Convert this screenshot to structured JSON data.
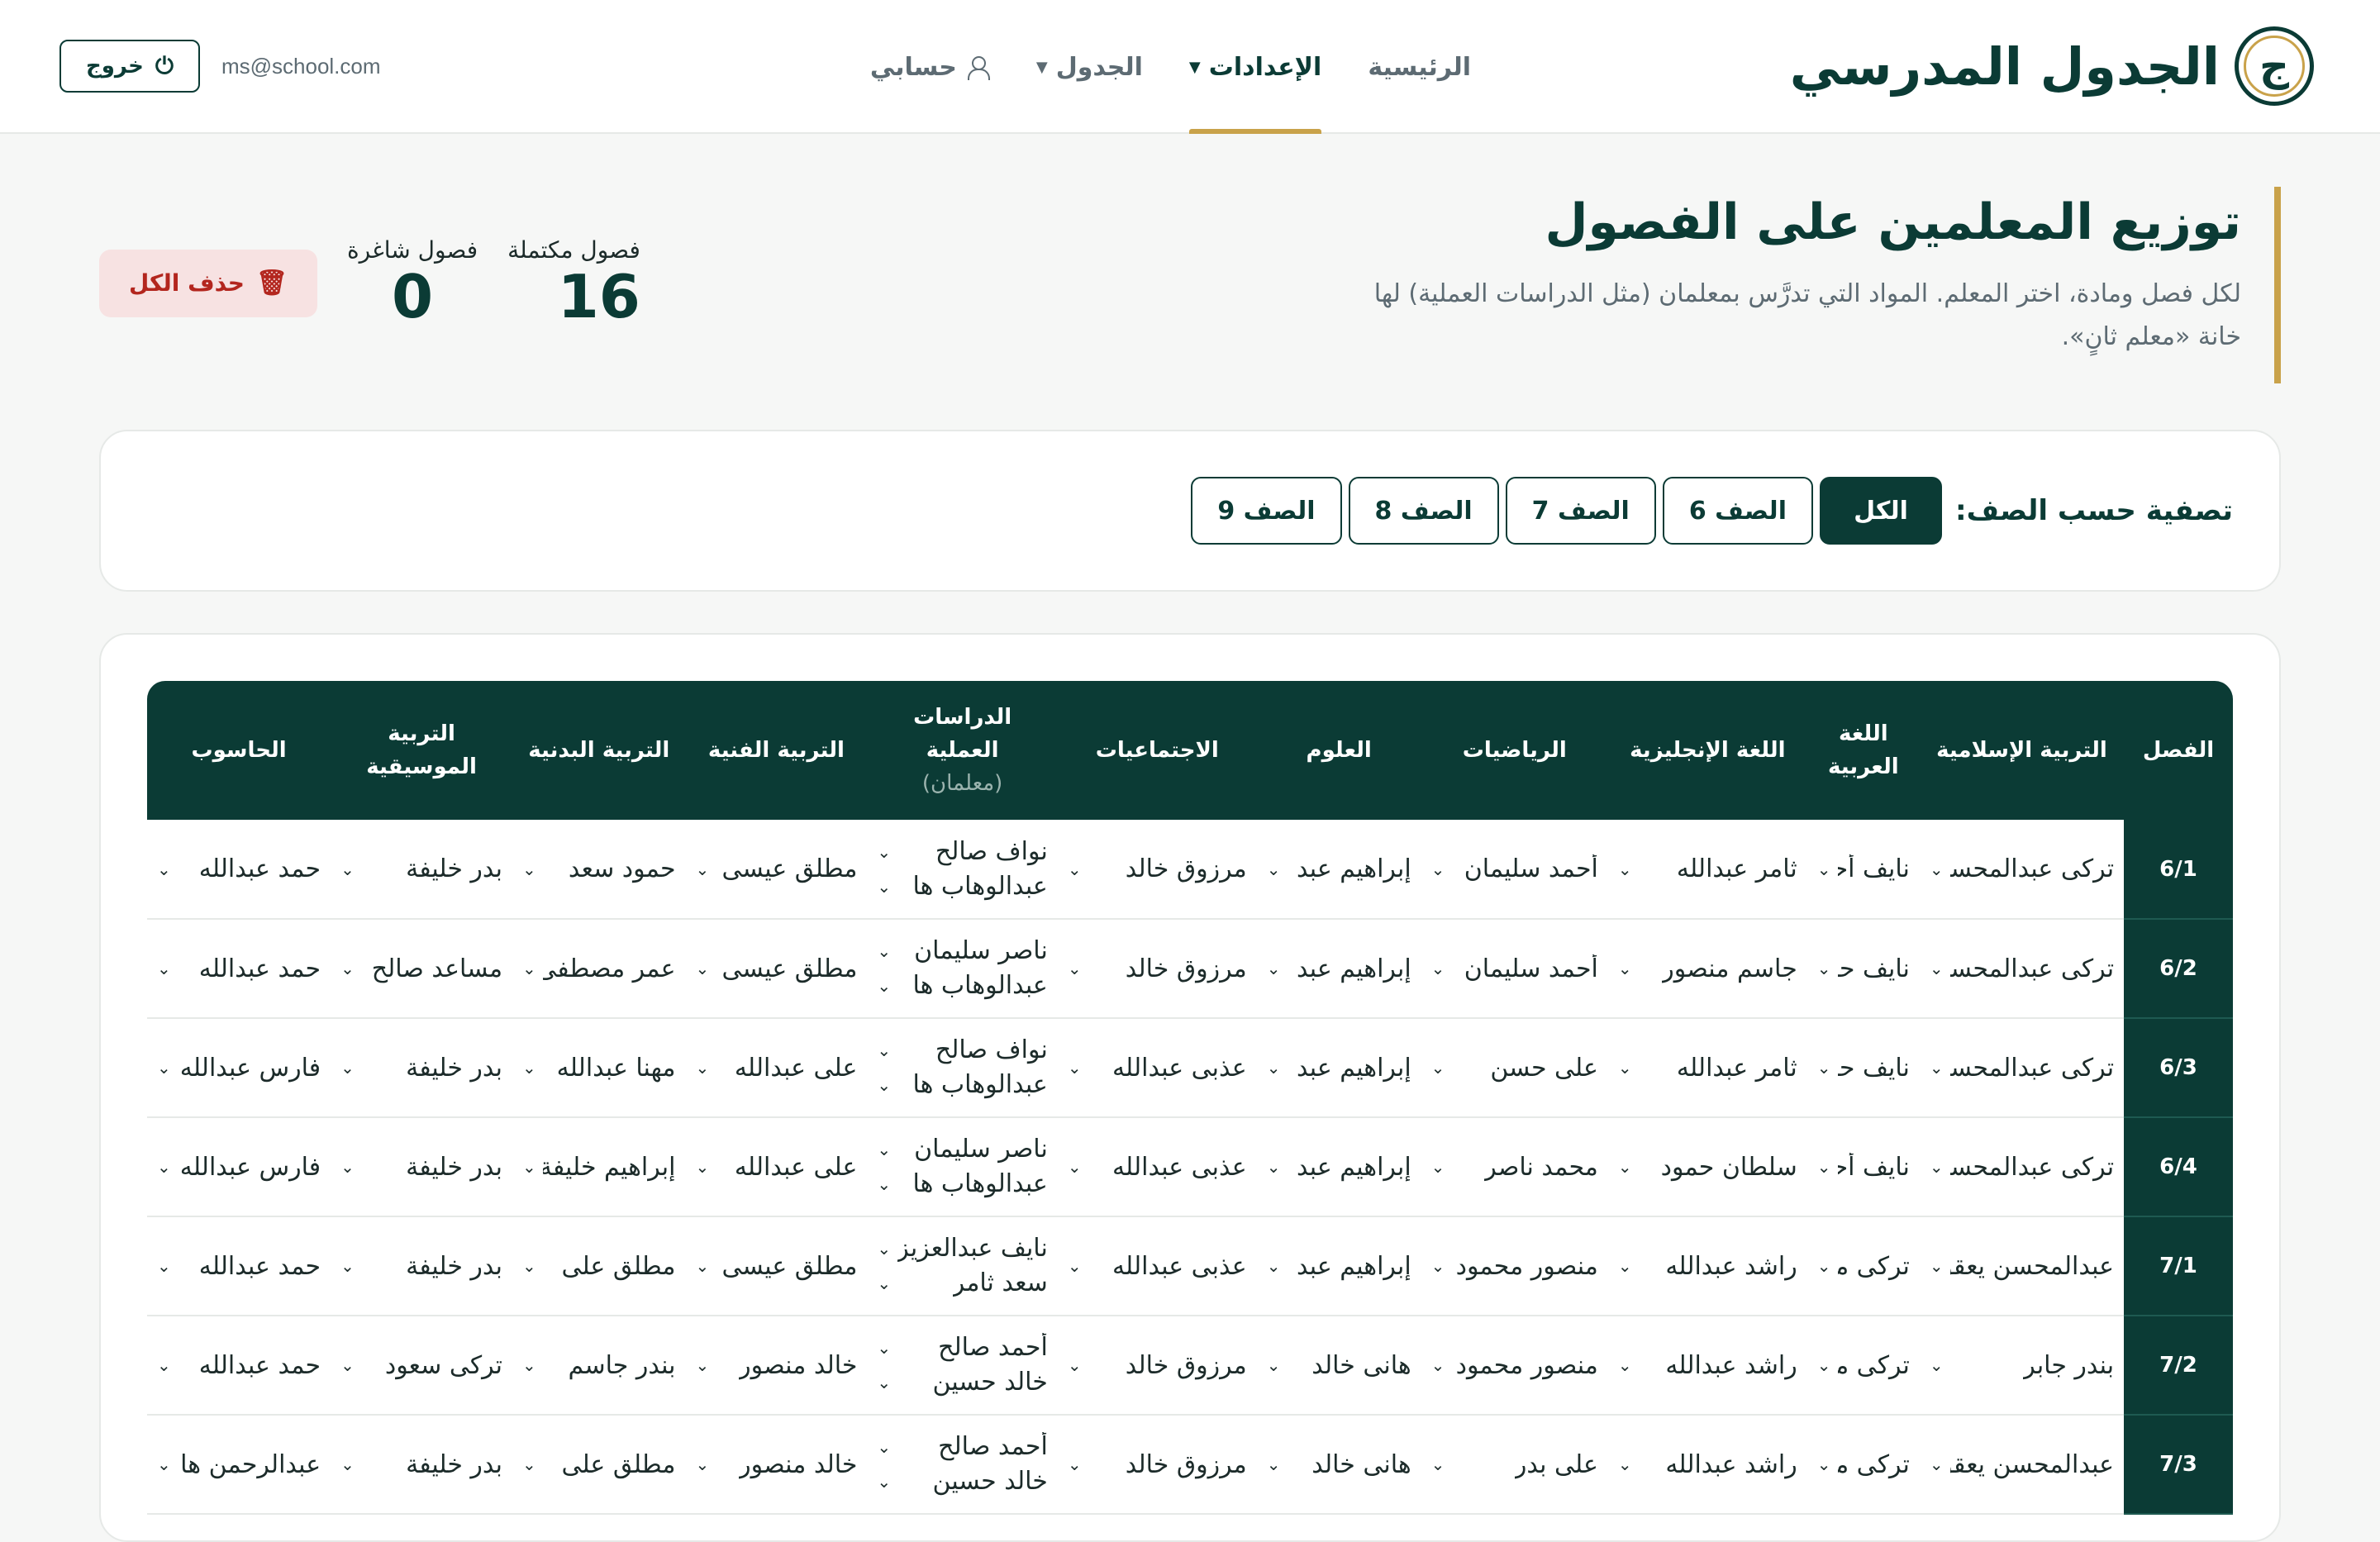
{
  "brand": {
    "name": "الجدول المدرسي",
    "logo_letter": "ج"
  },
  "nav": {
    "items": [
      {
        "label": "الرئيسية",
        "has_dropdown": false,
        "active": false
      },
      {
        "label": "الإعدادات",
        "has_dropdown": true,
        "active": true
      },
      {
        "label": "الجدول",
        "has_dropdown": true,
        "active": false
      },
      {
        "label": "حسابي",
        "has_dropdown": false,
        "active": false
      }
    ],
    "user_email": "ms@school.com",
    "logout_label": "خروج"
  },
  "page": {
    "title": "توزيع المعلمين على الفصول",
    "description": "لكل فصل ومادة، اختر المعلم. المواد التي تدرَّس بمعلمان (مثل الدراسات العملية) لها خانة «معلم ثانٍ».",
    "stats": {
      "complete_label": "فصول مكتملة",
      "complete_value": "16",
      "vacant_label": "فصول شاغرة",
      "vacant_value": "0"
    },
    "delete_all_label": "حذف الكل"
  },
  "filter": {
    "label": "تصفية حسب الصف:",
    "options": [
      "الكل",
      "الصف 6",
      "الصف 7",
      "الصف 8",
      "الصف 9"
    ],
    "selected": "الكل"
  },
  "table": {
    "headers": [
      {
        "label": "الفصل"
      },
      {
        "label": "التربية الإسلامية"
      },
      {
        "label": "اللغة العربية"
      },
      {
        "label": "اللغة الإنجليزية"
      },
      {
        "label": "الرياضيات"
      },
      {
        "label": "العلوم"
      },
      {
        "label": "الاجتماعيات"
      },
      {
        "label": "الدراسات العملية",
        "sub": "(معلمان)"
      },
      {
        "label": "التربية الفنية"
      },
      {
        "label": "التربية البدنية"
      },
      {
        "label": "التربية الموسيقية"
      },
      {
        "label": "الحاسوب"
      }
    ],
    "rows": [
      {
        "class": "6/1",
        "cells": [
          "تركى عبدالمحسن",
          "نايف أحمد",
          "ثامر عبدالله",
          "أحمد سليمان",
          "إبراهيم عبد",
          "مرزوق خالد",
          [
            "نواف صالح",
            "عبدالوهاب ها"
          ],
          "مطلق عيسى",
          "حمود سعد",
          "بدر خليفة",
          "حمد عبدالله"
        ]
      },
      {
        "class": "6/2",
        "cells": [
          "تركى عبدالمحسن",
          "نايف حسن",
          "جاسم منصور",
          "أحمد سليمان",
          "إبراهيم عبد",
          "مرزوق خالد",
          [
            "ناصر سليمان",
            "عبدالوهاب ها"
          ],
          "مطلق عيسى",
          "عمر مصطفى",
          "مساعد صالح",
          "حمد عبدالله"
        ]
      },
      {
        "class": "6/3",
        "cells": [
          "تركى عبدالمحسن",
          "نايف حسن",
          "ثامر عبدالله",
          "على حسن",
          "إبراهيم عبد",
          "عذبى عبدالله",
          [
            "نواف صالح",
            "عبدالوهاب ها"
          ],
          "على عبدالله",
          "مهنا عبدالله",
          "بدر خليفة",
          "فارس عبدالله"
        ]
      },
      {
        "class": "6/4",
        "cells": [
          "تركى عبدالمحسن",
          "نايف أحمد",
          "سلطان حمود",
          "محمد ناصر",
          "إبراهيم عبد",
          "عذبى عبدالله",
          [
            "ناصر سليمان",
            "عبدالوهاب ها"
          ],
          "على عبدالله",
          "إبراهيم خليفة",
          "بدر خليفة",
          "فارس عبدالله"
        ]
      },
      {
        "class": "7/1",
        "cells": [
          "عبدالمحسن يعقوب",
          "تركى محمد",
          "راشد عبدالله",
          "منصور محمود",
          "إبراهيم عبد",
          "عذبى عبدالله",
          [
            "نايف عبدالعزيز",
            "سعد ثامر"
          ],
          "مطلق عيسى",
          "مطلق على",
          "بدر خليفة",
          "حمد عبدالله"
        ]
      },
      {
        "class": "7/2",
        "cells": [
          "بندر جابر",
          "تركى محمد",
          "راشد عبدالله",
          "منصور محمود",
          "هانى خالد",
          "مرزوق خالد",
          [
            "أحمد صالح",
            "خالد حسين"
          ],
          "خالد منصور",
          "بندر جاسم",
          "تركى سعود",
          "حمد عبدالله"
        ]
      },
      {
        "class": "7/3",
        "cells": [
          "عبدالمحسن يعقوب",
          "تركى محمد",
          "راشد عبدالله",
          "على بدر",
          "هانى خالد",
          "مرزوق خالد",
          [
            "أحمد صالح",
            "خالد حسين"
          ],
          "خالد منصور",
          "مطلق على",
          "بدر خليفة",
          "عبدالرحمن ها"
        ]
      }
    ]
  }
}
